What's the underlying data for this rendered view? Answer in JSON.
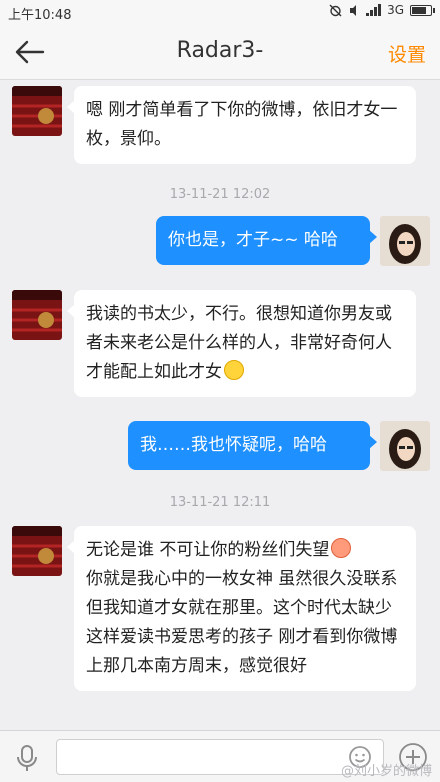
{
  "status_bar": {
    "time": "上午10:48",
    "network": "3G"
  },
  "header": {
    "back_icon": "back-arrow-icon",
    "title": "Radar3-",
    "settings_label": "设置",
    "accent_color": "#ff8a00"
  },
  "messages": [
    {
      "direction": "incoming",
      "text": "嗯 刚才简单看了下你的微博，依旧才女一枚，景仰。"
    },
    {
      "direction": "timestamp",
      "text": "13-11-21 12:02"
    },
    {
      "direction": "outgoing",
      "text": "你也是，才子~~ 哈哈"
    },
    {
      "direction": "incoming",
      "text": "我读的书太少，不行。很想知道你男友或者未来老公是什么样的人，非常好奇何人才能配上如此才女",
      "emoji": "thinking-face-icon"
    },
    {
      "direction": "outgoing",
      "text": "我……我也怀疑呢，哈哈"
    },
    {
      "direction": "timestamp",
      "text": "13-11-21 12:11"
    },
    {
      "direction": "incoming",
      "text": "无论是谁 不可让你的粉丝们失望",
      "text_2": "你就是我心中的一枚女神 虽然很久没联系 但我知道才女就在那里。这个时代太缺少这样爱读书爱思考的孩子 刚才看到你微博上那几本南方周末，感觉很好",
      "emoji": "pig-face-icon"
    }
  ],
  "input_bar": {
    "mic_icon": "microphone-icon",
    "input_value": "",
    "input_placeholder": "",
    "emoji_icon": "smiley-icon",
    "plus_icon": "plus-circle-icon"
  },
  "watermark": "@刘小岁的微博",
  "colors": {
    "outgoing_bubble": "#1e90ff",
    "incoming_bubble": "#ffffff",
    "background": "#efeff2"
  }
}
